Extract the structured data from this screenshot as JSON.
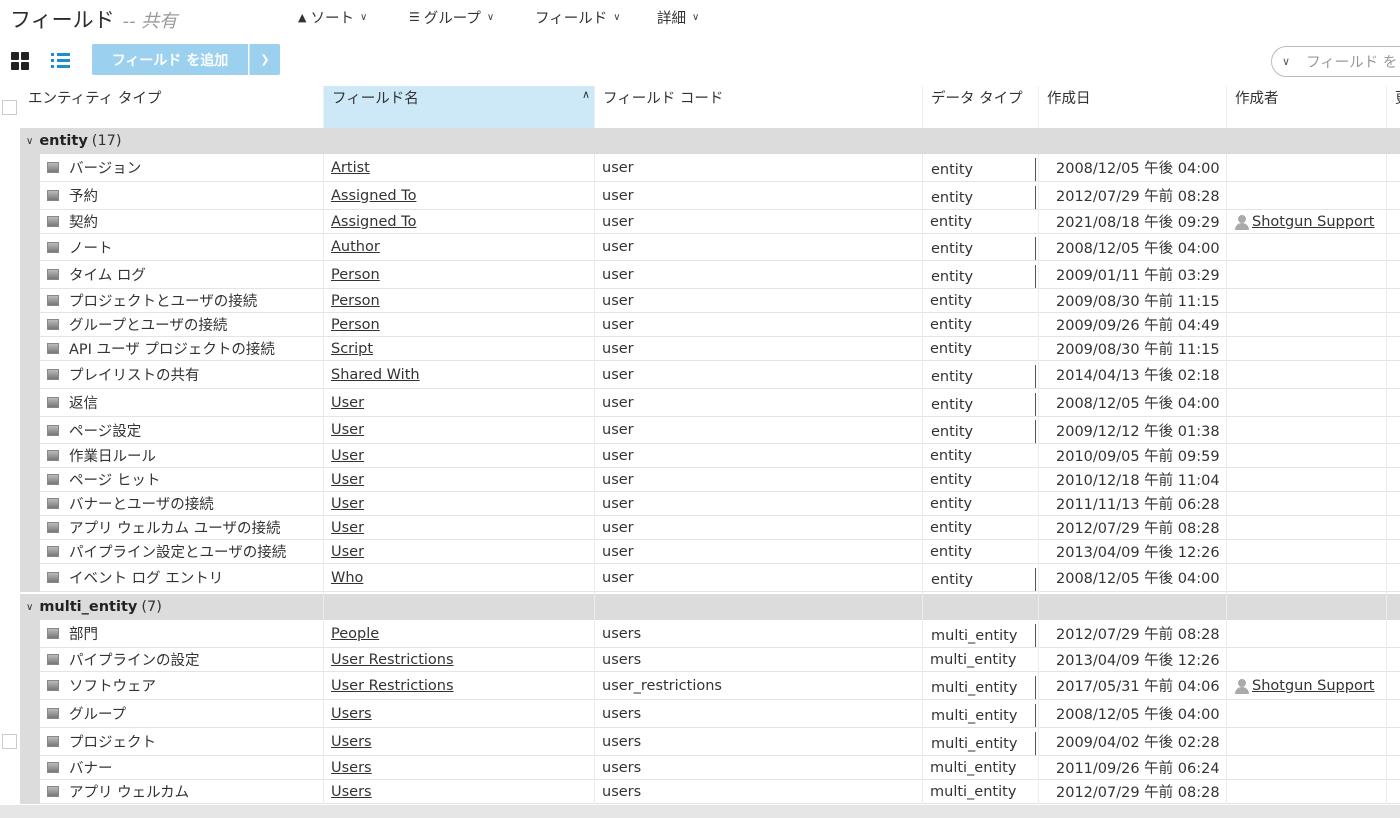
{
  "page": {
    "title": "フィールド",
    "subtitle": "-- 共有"
  },
  "toolbar": {
    "add_field": "フィールド を追加",
    "sort": "ソート",
    "group": "グループ",
    "fields": "フィールド",
    "details": "詳細",
    "search_placeholder": "フィールド を"
  },
  "columns": {
    "entity_type": "エンティティ タイプ",
    "field_name": "フィールド名",
    "field_code": "フィールド コード",
    "data_type": "データ タイプ",
    "created": "作成日",
    "creator": "作成者",
    "more": "更"
  },
  "groups": [
    {
      "name": "entity",
      "count": "(17)",
      "rows": [
        {
          "entity": "バージョン",
          "name": "Artist",
          "code": "user",
          "type": "entity",
          "boxed": true,
          "date": "2008/12/05 午後 04:00",
          "user": ""
        },
        {
          "entity": "予約",
          "name": "Assigned To",
          "code": "user",
          "type": "entity",
          "boxed": true,
          "date": "2012/07/29 午前 08:28",
          "user": ""
        },
        {
          "entity": "契約",
          "name": "Assigned To",
          "code": "user",
          "type": "entity",
          "boxed": false,
          "date": "2021/08/18 午後 09:29",
          "user": "Shotgun Support"
        },
        {
          "entity": "ノート",
          "name": "Author",
          "code": "user",
          "type": "entity",
          "boxed": true,
          "date": "2008/12/05 午後 04:00",
          "user": ""
        },
        {
          "entity": "タイム ログ",
          "name": "Person",
          "code": "user",
          "type": "entity",
          "boxed": true,
          "date": "2009/01/11 午前 03:29",
          "user": ""
        },
        {
          "entity": "プロジェクトとユーザの接続",
          "name": "Person",
          "code": "user",
          "type": "entity",
          "boxed": false,
          "date": "2009/08/30 午前 11:15",
          "user": ""
        },
        {
          "entity": "グループとユーザの接続",
          "name": "Person",
          "code": "user",
          "type": "entity",
          "boxed": false,
          "date": "2009/09/26 午前 04:49",
          "user": ""
        },
        {
          "entity": "API ユーザ プロジェクトの接続",
          "name": "Script",
          "code": "user",
          "type": "entity",
          "boxed": false,
          "date": "2009/08/30 午前 11:15",
          "user": ""
        },
        {
          "entity": "プレイリストの共有",
          "name": "Shared With",
          "code": "user",
          "type": "entity",
          "boxed": true,
          "date": "2014/04/13 午後 02:18",
          "user": ""
        },
        {
          "entity": "返信",
          "name": "User",
          "code": "user",
          "type": "entity",
          "boxed": true,
          "date": "2008/12/05 午後 04:00",
          "user": ""
        },
        {
          "entity": "ページ設定",
          "name": "User",
          "code": "user",
          "type": "entity",
          "boxed": true,
          "date": "2009/12/12 午後 01:38",
          "user": ""
        },
        {
          "entity": "作業日ルール",
          "name": "User",
          "code": "user",
          "type": "entity",
          "boxed": false,
          "date": "2010/09/05 午前 09:59",
          "user": ""
        },
        {
          "entity": "ページ ヒット",
          "name": "User",
          "code": "user",
          "type": "entity",
          "boxed": false,
          "date": "2010/12/18 午前 11:04",
          "user": ""
        },
        {
          "entity": "バナーとユーザの接続",
          "name": "User",
          "code": "user",
          "type": "entity",
          "boxed": false,
          "date": "2011/11/13 午前 06:28",
          "user": ""
        },
        {
          "entity": "アプリ ウェルカム ユーザの接続",
          "name": "User",
          "code": "user",
          "type": "entity",
          "boxed": false,
          "date": "2012/07/29 午前 08:28",
          "user": ""
        },
        {
          "entity": "パイプライン設定とユーザの接続",
          "name": "User",
          "code": "user",
          "type": "entity",
          "boxed": false,
          "date": "2013/04/09 午後 12:26",
          "user": ""
        },
        {
          "entity": "イベント ログ エントリ",
          "name": "Who",
          "code": "user",
          "type": "entity",
          "boxed": true,
          "date": "2008/12/05 午後 04:00",
          "user": ""
        }
      ]
    },
    {
      "name": "multi_entity",
      "count": "(7)",
      "rows": [
        {
          "entity": "部門",
          "name": "People",
          "code": "users",
          "type": "multi_entity",
          "boxed": true,
          "date": "2012/07/29 午前 08:28",
          "user": ""
        },
        {
          "entity": "パイプラインの設定",
          "name": "User Restrictions",
          "code": "users",
          "type": "multi_entity",
          "boxed": false,
          "date": "2013/04/09 午後 12:26",
          "user": ""
        },
        {
          "entity": "ソフトウェア",
          "name": "User Restrictions",
          "code": "user_restrictions",
          "type": "multi_entity",
          "boxed": true,
          "date": "2017/05/31 午前 04:06",
          "user": "Shotgun Support"
        },
        {
          "entity": "グループ",
          "name": "Users",
          "code": "users",
          "type": "multi_entity",
          "boxed": true,
          "date": "2008/12/05 午後 04:00",
          "user": ""
        },
        {
          "entity": "プロジェクト",
          "name": "Users",
          "code": "users",
          "type": "multi_entity",
          "boxed": true,
          "date": "2009/04/02 午後 02:28",
          "user": ""
        },
        {
          "entity": "バナー",
          "name": "Users",
          "code": "users",
          "type": "multi_entity",
          "boxed": false,
          "date": "2011/09/26 午前 06:24",
          "user": ""
        },
        {
          "entity": "アプリ ウェルカム",
          "name": "Users",
          "code": "users",
          "type": "multi_entity",
          "boxed": false,
          "date": "2012/07/29 午前 08:28",
          "user": ""
        }
      ]
    }
  ]
}
